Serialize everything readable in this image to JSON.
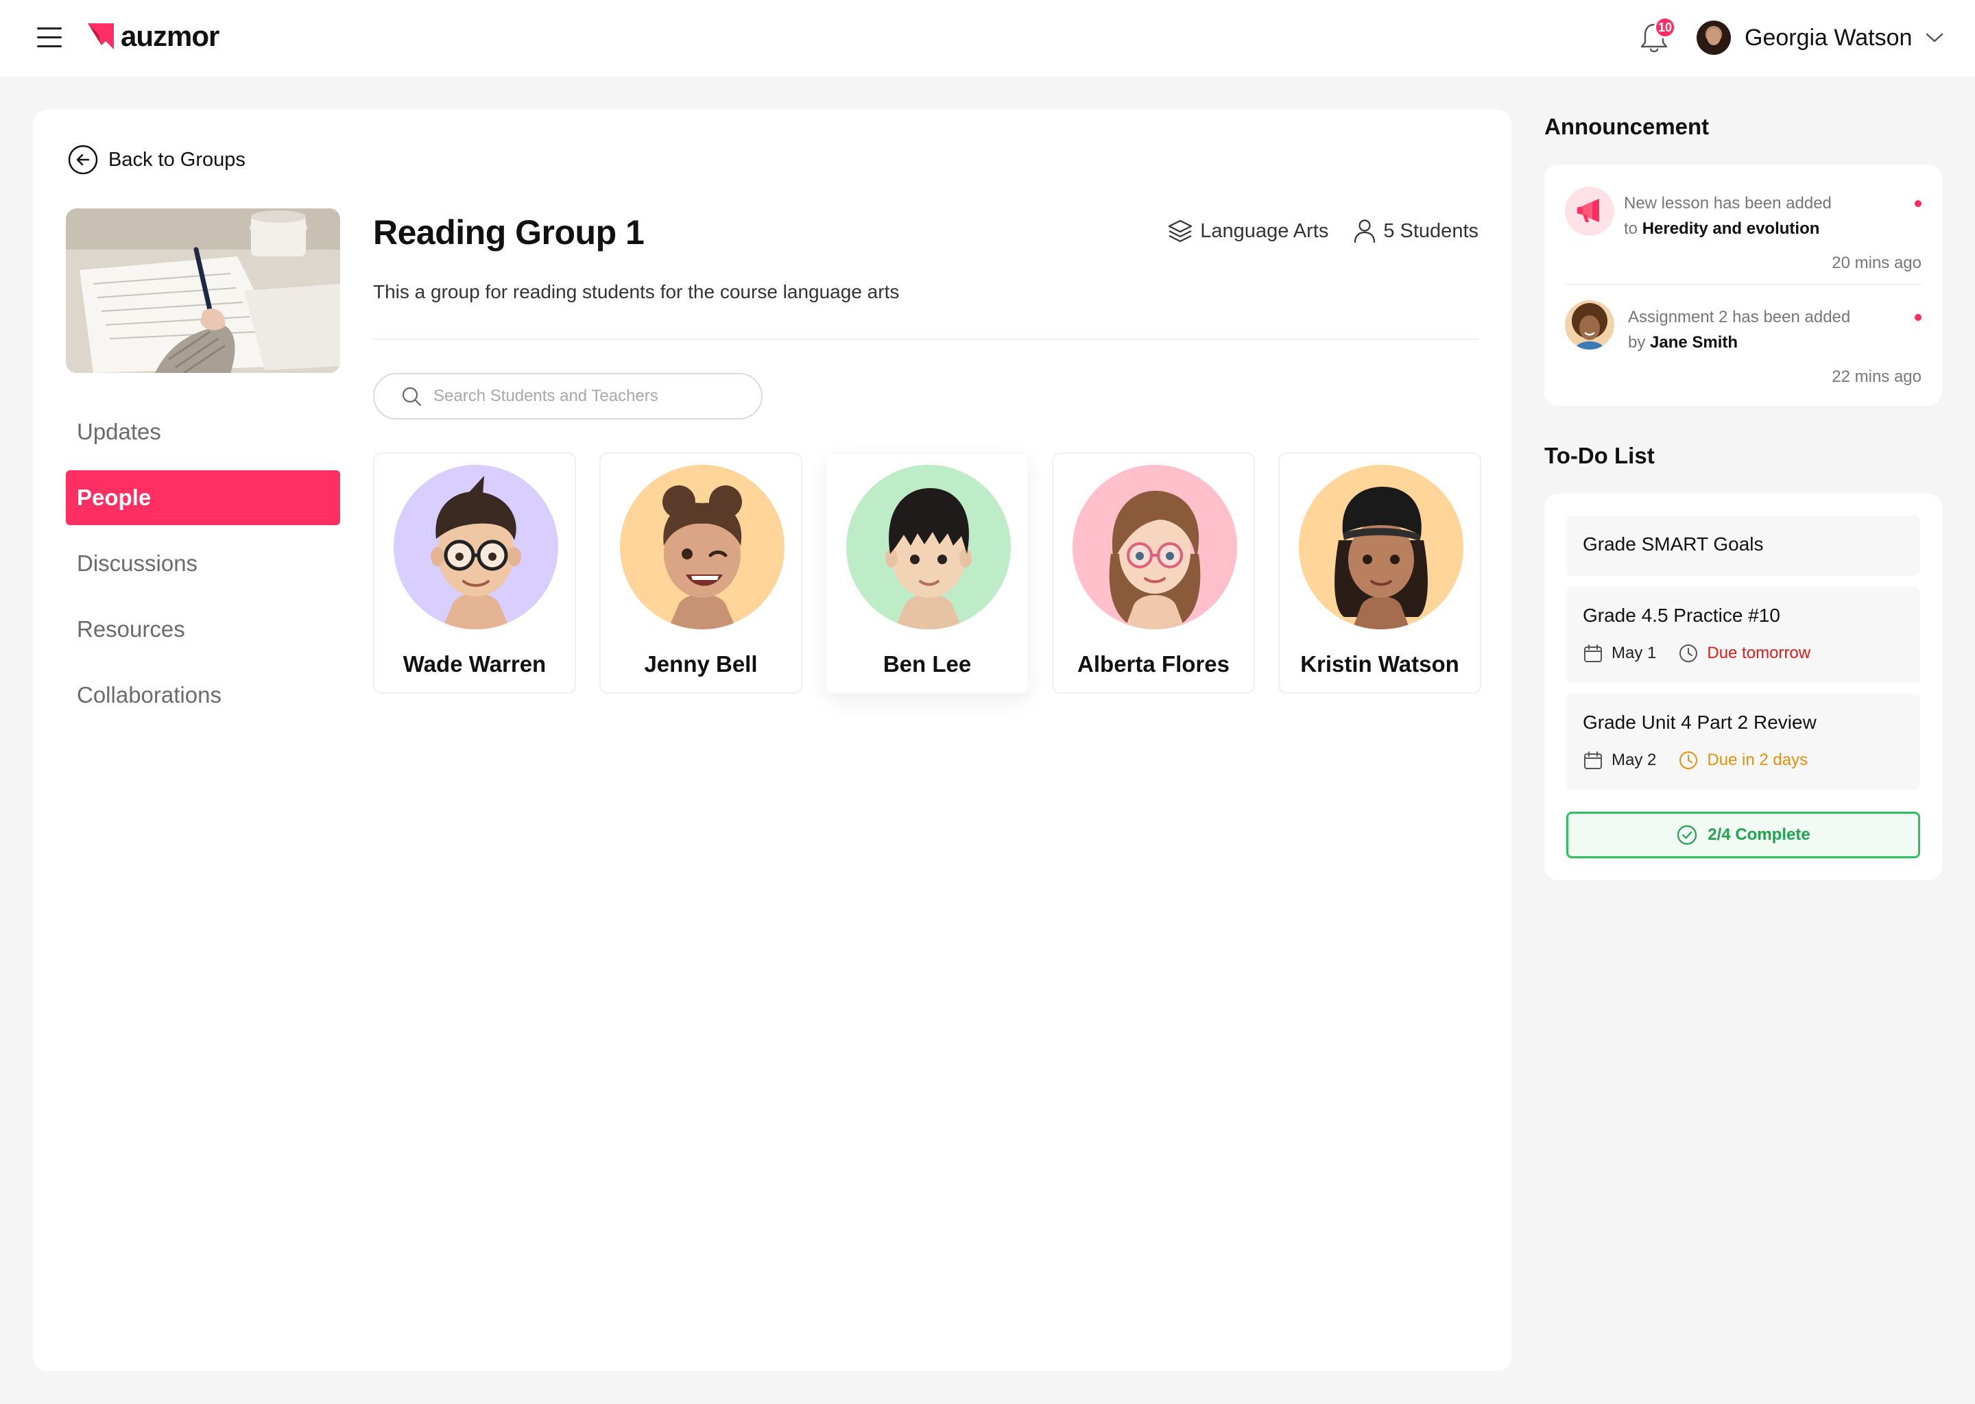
{
  "brand": {
    "name": "auzmor",
    "accent": "#ff2e63"
  },
  "header": {
    "notification_count": "10",
    "user_name": "Georgia Watson"
  },
  "back": {
    "label": "Back to Groups"
  },
  "group": {
    "title": "Reading Group 1",
    "subject": "Language Arts",
    "students": "5 Students",
    "description": "This a group for reading students for the course language arts"
  },
  "nav": {
    "items": [
      {
        "label": "Updates",
        "active": false
      },
      {
        "label": "People",
        "active": true
      },
      {
        "label": "Discussions",
        "active": false
      },
      {
        "label": "Resources",
        "active": false
      },
      {
        "label": "Collaborations",
        "active": false
      }
    ]
  },
  "search": {
    "placeholder": "Search Students and Teachers",
    "value": ""
  },
  "people": [
    {
      "name": "Wade Warren",
      "bg": "#d8ceff"
    },
    {
      "name": "Jenny Bell",
      "bg": "#ffd59a"
    },
    {
      "name": "Ben Lee",
      "bg": "#bdecc6"
    },
    {
      "name": "Alberta Flores",
      "bg": "#ffc0cc"
    },
    {
      "name": "Kristin Watson",
      "bg": "#ffd59a"
    }
  ],
  "announcement": {
    "title": "Announcement",
    "items": [
      {
        "text_prefix": "New lesson has been added",
        "connector": "to",
        "highlight": "Heredity and evolution",
        "time": "20 mins ago",
        "icon": "megaphone-icon"
      },
      {
        "text_prefix": "Assignment 2 has been added",
        "connector": "by",
        "highlight": "Jane Smith",
        "time": "22 mins ago",
        "icon": "avatar"
      }
    ]
  },
  "todo": {
    "title": "To-Do List",
    "items": [
      {
        "title": "Grade SMART Goals"
      },
      {
        "title": "Grade 4.5 Practice #10",
        "date": "May 1",
        "due": "Due tomorrow",
        "due_color": "#e21b1b"
      },
      {
        "title": "Grade Unit 4 Part 2 Review",
        "date": "May 2",
        "due": "Due in 2 days",
        "due_color": "#e6900c"
      }
    ],
    "complete_label": "2/4 Complete",
    "complete_color": "#22a34f"
  }
}
